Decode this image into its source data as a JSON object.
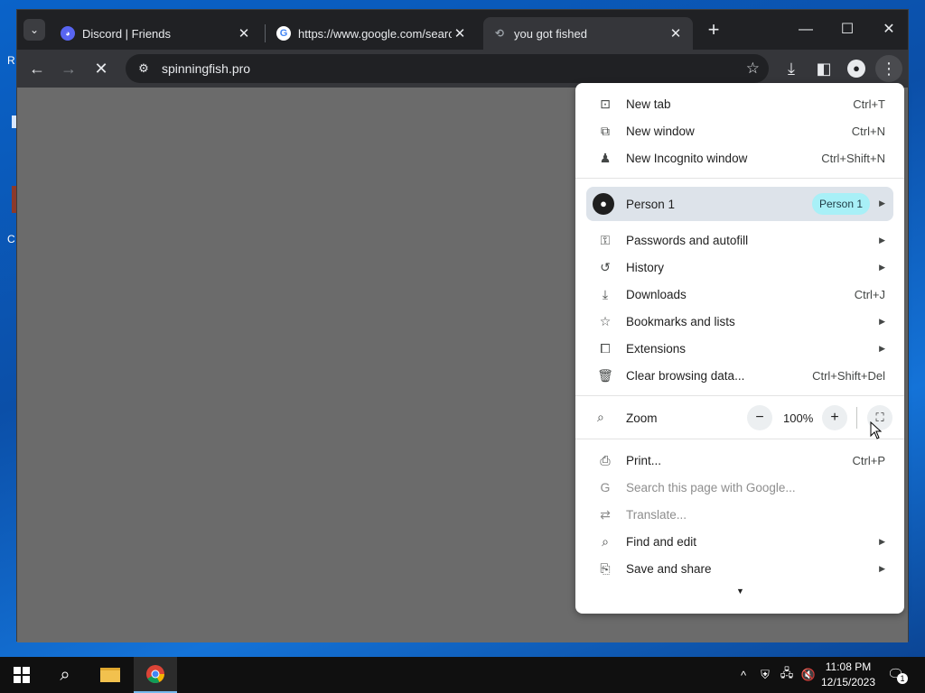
{
  "desktop": {
    "edge_letters": [
      "R",
      "C"
    ]
  },
  "browser": {
    "tabs": [
      {
        "title": "Discord | Friends",
        "favicon": "discord-icon",
        "active": false
      },
      {
        "title": "https://www.google.com/search",
        "favicon": "google-icon",
        "active": false
      },
      {
        "title": "you got fished",
        "favicon": "fish-icon",
        "active": true
      }
    ],
    "toolbar": {
      "url": "spinningfish.pro",
      "loading": true
    },
    "menu": {
      "items_top": [
        {
          "label": "New tab",
          "shortcut": "Ctrl+T",
          "icon": "new-tab-icon"
        },
        {
          "label": "New window",
          "shortcut": "Ctrl+N",
          "icon": "new-window-icon"
        },
        {
          "label": "New Incognito window",
          "shortcut": "Ctrl+Shift+N",
          "icon": "incognito-icon"
        }
      ],
      "profile": {
        "label": "Person 1",
        "badge": "Person 1"
      },
      "items_mid": [
        {
          "label": "Passwords and autofill",
          "icon": "key-icon",
          "submenu": true
        },
        {
          "label": "History",
          "icon": "history-icon",
          "submenu": true
        },
        {
          "label": "Downloads",
          "shortcut": "Ctrl+J",
          "icon": "download-icon"
        },
        {
          "label": "Bookmarks and lists",
          "icon": "star-icon",
          "submenu": true
        },
        {
          "label": "Extensions",
          "icon": "puzzle-icon",
          "submenu": true
        },
        {
          "label": "Clear browsing data...",
          "shortcut": "Ctrl+Shift+Del",
          "icon": "trash-icon"
        }
      ],
      "zoom": {
        "label": "Zoom",
        "value": "100%",
        "minus": "−",
        "plus": "+"
      },
      "items_bottom": [
        {
          "label": "Print...",
          "shortcut": "Ctrl+P",
          "icon": "print-icon"
        },
        {
          "label": "Search this page with Google...",
          "icon": "google-g-icon",
          "disabled": true
        },
        {
          "label": "Translate...",
          "icon": "translate-icon",
          "disabled": true
        },
        {
          "label": "Find and edit",
          "icon": "find-icon",
          "submenu": true
        },
        {
          "label": "Save and share",
          "icon": "save-share-icon",
          "submenu": true
        }
      ]
    }
  },
  "taskbar": {
    "time": "11:08 PM",
    "date": "12/15/2023",
    "notification_count": "1"
  }
}
